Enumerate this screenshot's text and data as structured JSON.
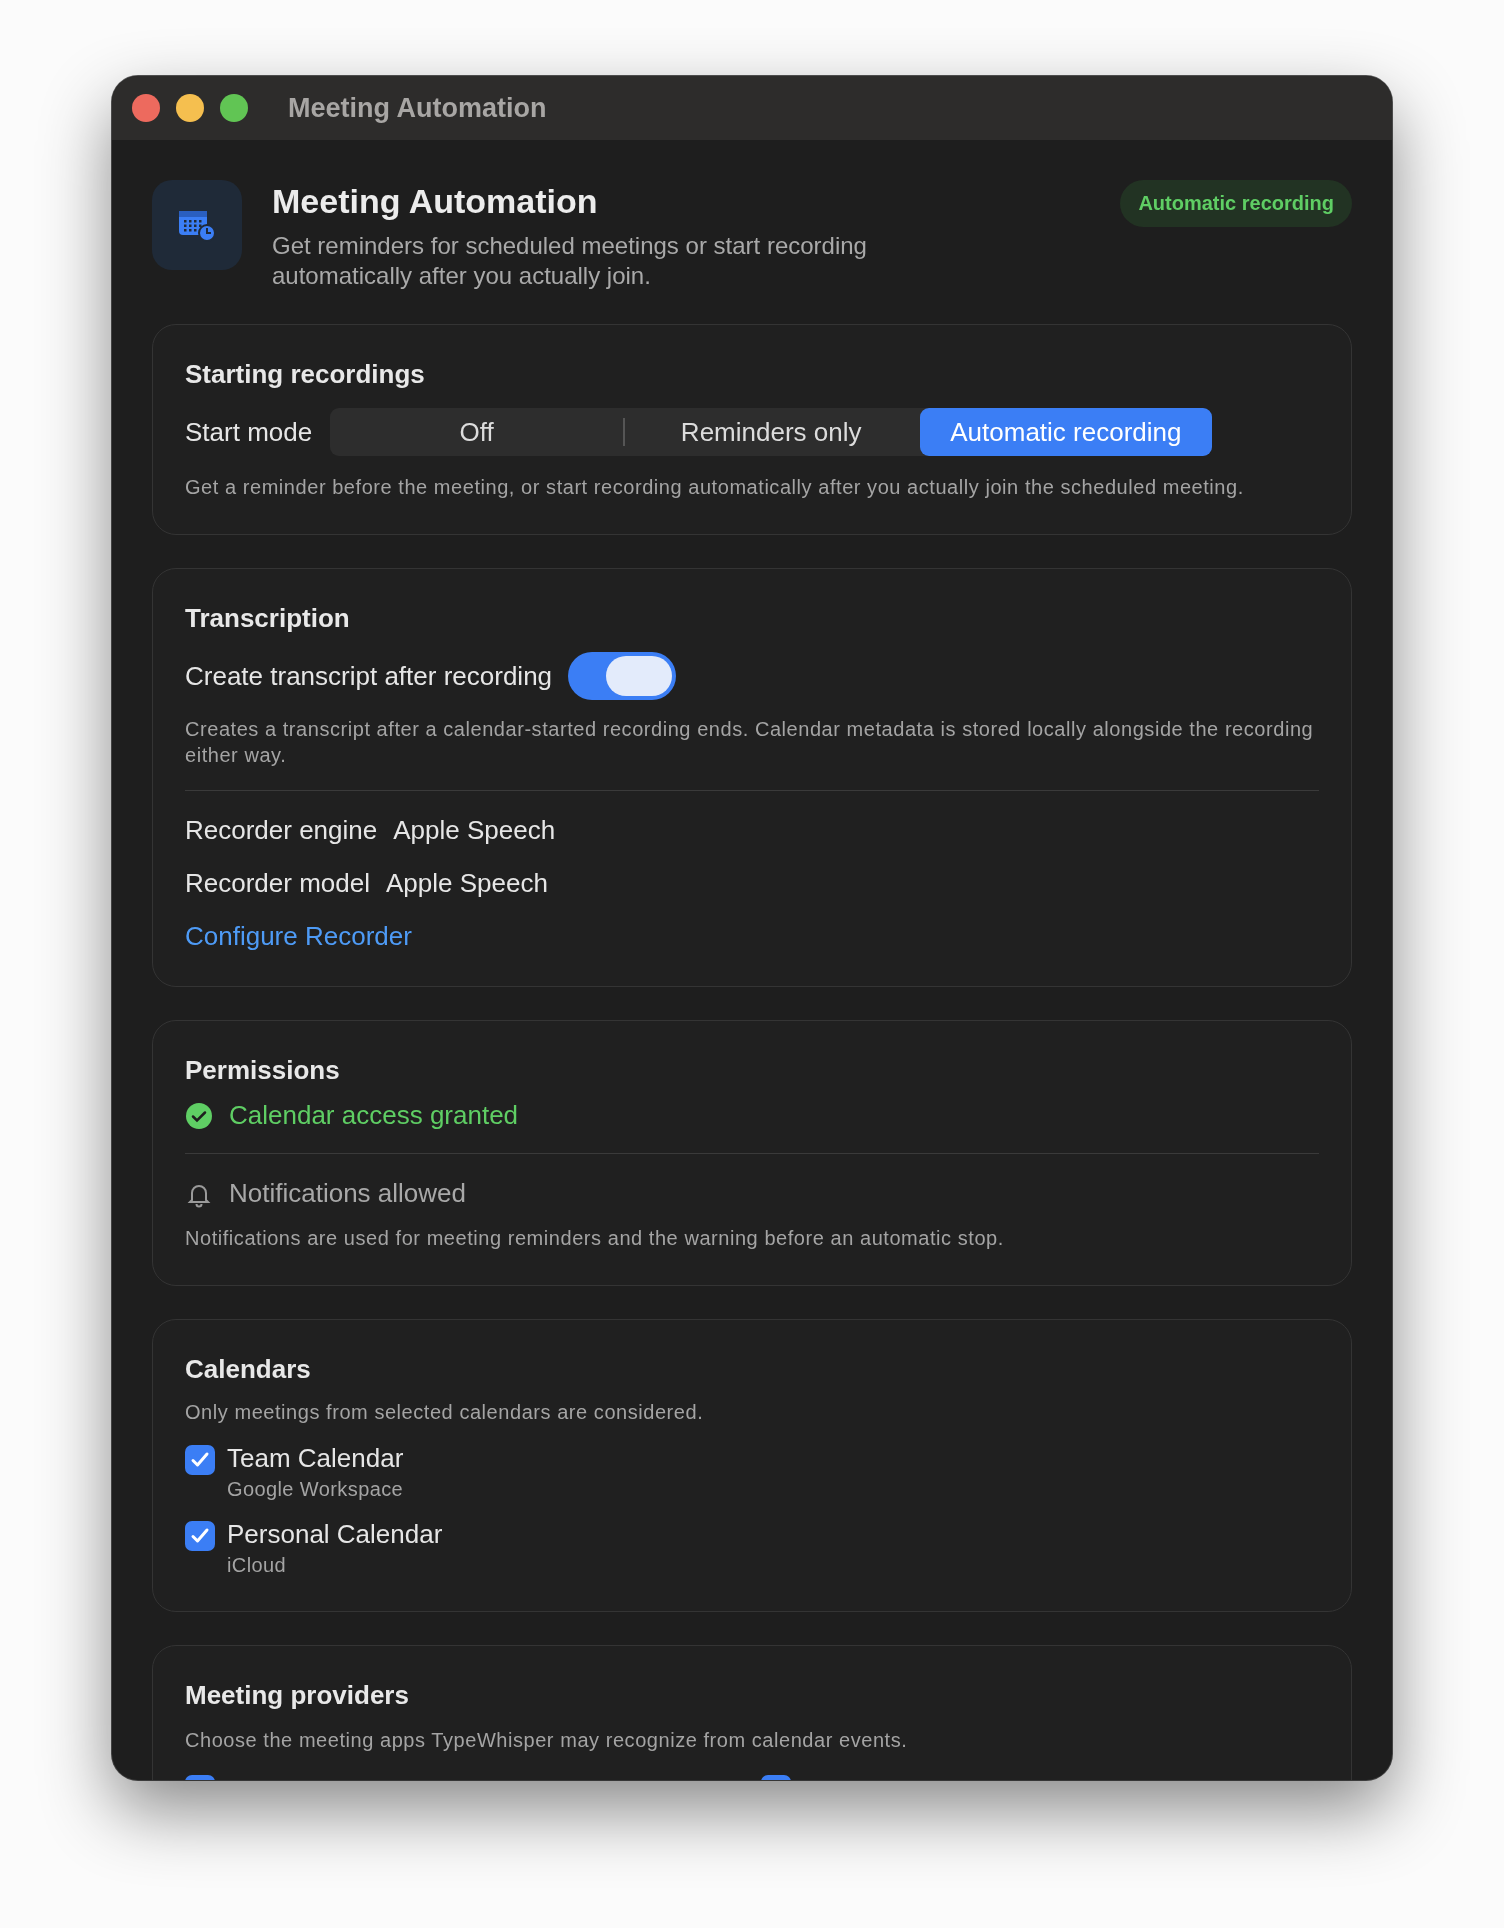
{
  "window": {
    "title": "Meeting Automation"
  },
  "header": {
    "title": "Meeting Automation",
    "subtitle": "Get reminders for scheduled meetings or start recording automatically after you actually join.",
    "badge": "Automatic recording"
  },
  "starting": {
    "title": "Starting recordings",
    "label": "Start mode",
    "options": [
      {
        "label": "Off",
        "selected": false
      },
      {
        "label": "Reminders only",
        "selected": false
      },
      {
        "label": "Automatic recording",
        "selected": true
      }
    ],
    "note": "Get a reminder before the meeting, or start recording automatically after you actually join the scheduled meeting."
  },
  "transcription": {
    "title": "Transcription",
    "toggle_label": "Create transcript after recording",
    "on": true,
    "note": "Creates a transcript after a calendar-started recording ends. Calendar metadata is stored locally alongside the recording either way.",
    "rows": [
      {
        "label": "Recorder engine",
        "value": "Apple Speech"
      },
      {
        "label": "Recorder model",
        "value": "Apple Speech"
      }
    ],
    "link": "Configure Recorder"
  },
  "permissions": {
    "title": "Permissions",
    "items": [
      {
        "kind": "granted",
        "label": "Calendar access granted"
      },
      {
        "kind": "notification",
        "label": "Notifications allowed"
      }
    ],
    "note": "Notifications are used for meeting reminders and the warning before an automatic stop."
  },
  "calendars": {
    "title": "Calendars",
    "note": "Only meetings from selected calendars are considered.",
    "items": [
      {
        "name": "Team Calendar",
        "account": "Google Workspace",
        "checked": true
      },
      {
        "name": "Personal Calendar",
        "account": "iCloud",
        "checked": true
      }
    ]
  },
  "providers": {
    "title": "Meeting providers",
    "note": "Choose the meeting apps TypeWhisper may recognize from calendar events.",
    "items": [
      {
        "checked": true
      },
      {
        "checked": true
      }
    ]
  }
}
